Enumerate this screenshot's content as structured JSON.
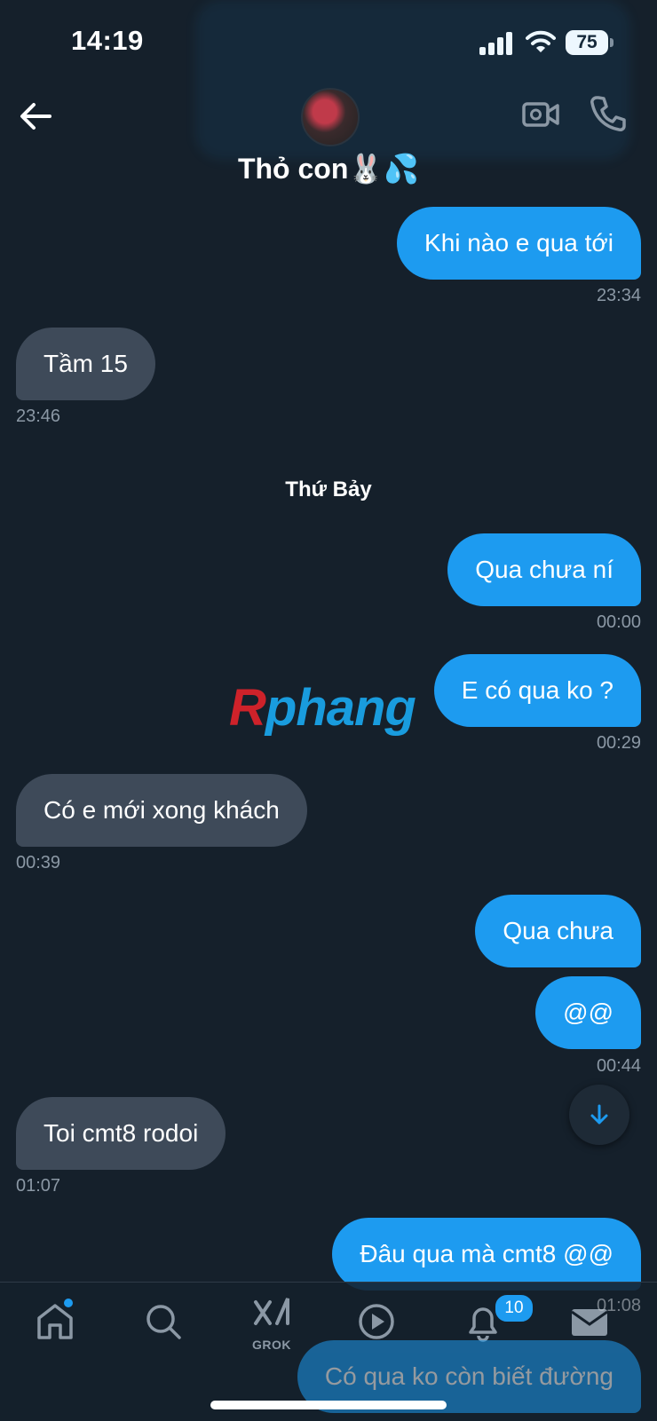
{
  "status_bar": {
    "time": "14:19",
    "battery": "75"
  },
  "header": {
    "contact_name": "Thỏ con🐰💦"
  },
  "day_separator": "Thứ Bảy",
  "watermark": {
    "first": "R",
    "rest": "phang"
  },
  "messages": [
    {
      "dir": "out",
      "text": "Khi nào e qua tới",
      "time": "23:34"
    },
    {
      "dir": "in",
      "text": "Tầm 15",
      "time": "23:46"
    },
    {
      "dir": "out",
      "text": "Qua chưa ní",
      "time": "00:00"
    },
    {
      "dir": "out",
      "text": "E có qua ko ?",
      "time": "00:29"
    },
    {
      "dir": "in",
      "text": "Có e mới xong khách",
      "time": "00:39"
    },
    {
      "dir": "out",
      "text": "Qua chưa",
      "time": ""
    },
    {
      "dir": "out",
      "text": "@@",
      "time": "00:44"
    },
    {
      "dir": "in",
      "text": "Toi cmt8 rodoi",
      "time": "01:07"
    },
    {
      "dir": "out",
      "text": "Đâu qua mà cmt8 @@",
      "time": "01:08"
    },
    {
      "dir": "out",
      "text": "Có qua ko còn biết đường",
      "time": ""
    }
  ],
  "nav": {
    "grok_label": "GROK",
    "notifications_count": "10"
  },
  "colors": {
    "background": "#15202b",
    "outgoing": "#1d9bf0",
    "incoming": "#3e4a59",
    "timestamp": "#8b98a5"
  }
}
